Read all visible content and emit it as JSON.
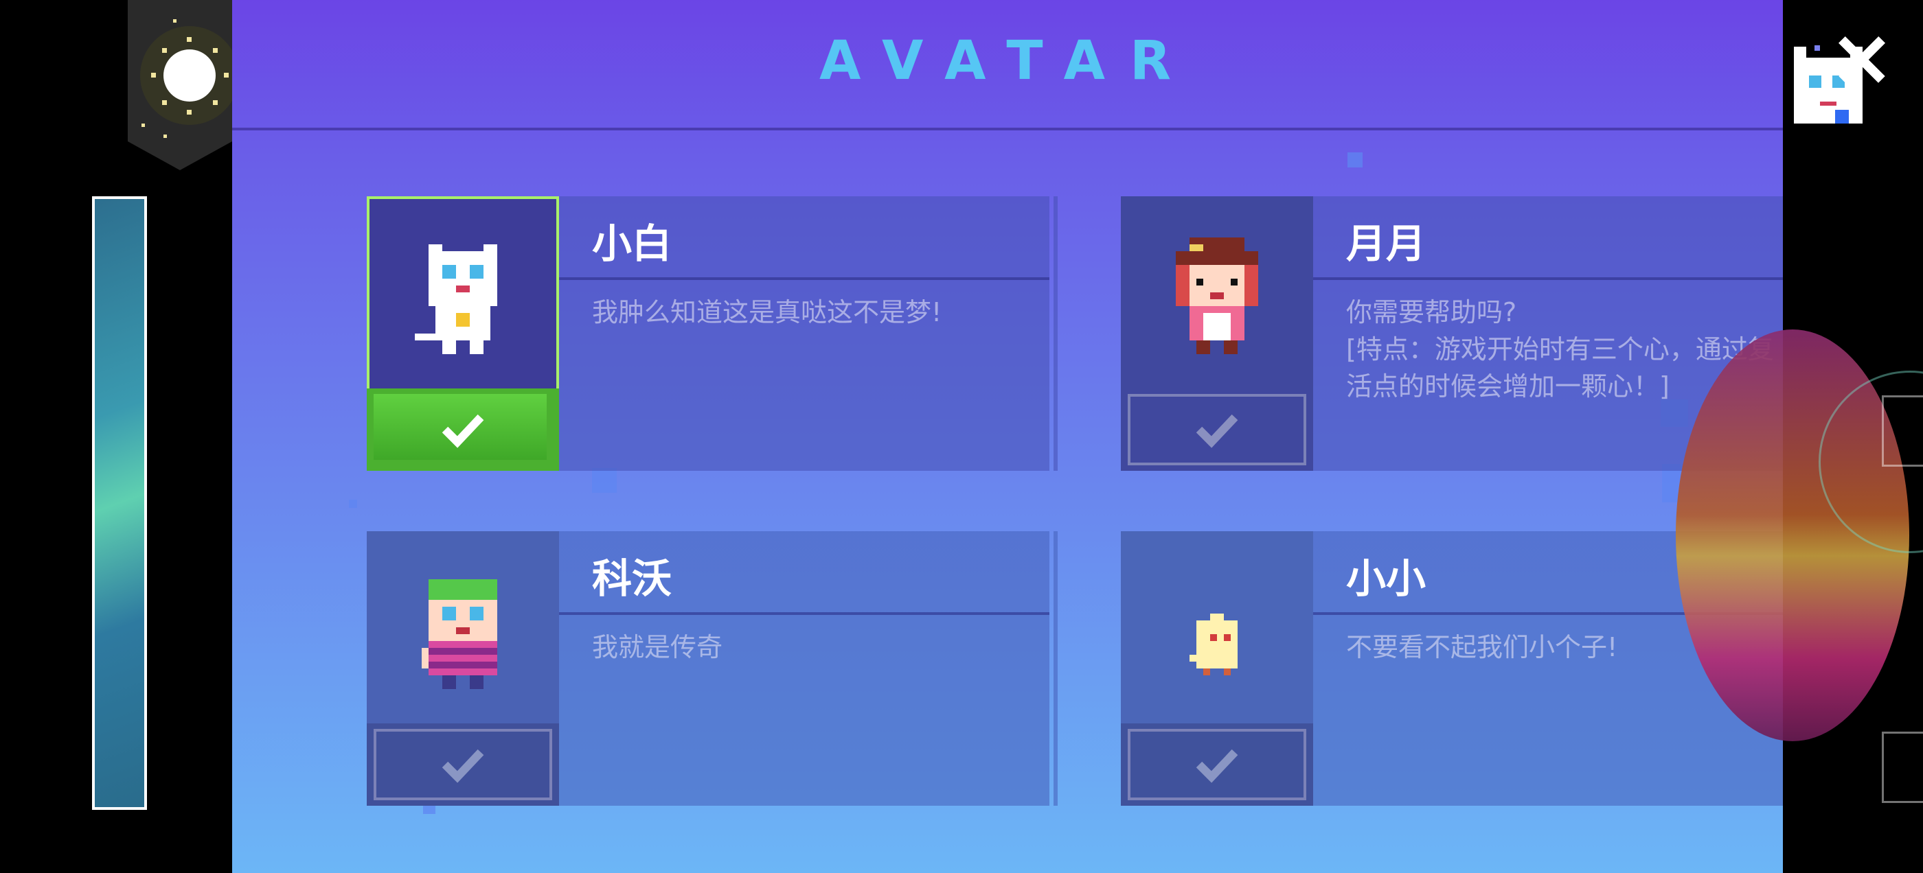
{
  "header": {
    "title": "AVATAR"
  },
  "avatars": [
    {
      "name": "小白",
      "description": "我肿么知道这是真哒这不是梦!",
      "selected": true
    },
    {
      "name": "月月",
      "description": "你需要帮助吗?\n[特点：游戏开始时有三个心，通过复活点的时候会增加一颗心！]",
      "selected": false
    },
    {
      "name": "科沃",
      "description": "我就是传奇",
      "selected": false
    },
    {
      "name": "小小",
      "description": "不要看不起我们小个子!",
      "selected": false
    }
  ],
  "icons": {
    "close": "close-icon",
    "check": "checkmark-icon",
    "sun": "sun-icon"
  },
  "colors": {
    "title": "#56c6f4",
    "selected_button": "#4bb030",
    "selected_frame": "#a9f06a"
  }
}
